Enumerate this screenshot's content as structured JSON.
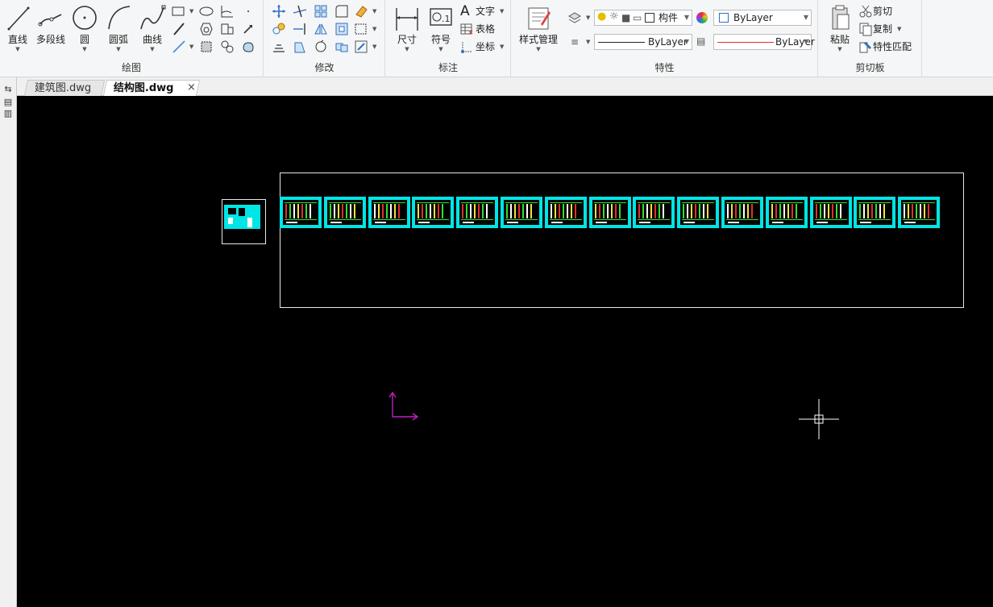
{
  "ribbon": {
    "draw": {
      "title": "绘图",
      "line": "直线",
      "polyline": "多段线",
      "circle": "圆",
      "arc": "圆弧",
      "spline": "曲线"
    },
    "modify": {
      "title": "修改"
    },
    "annotate": {
      "title": "标注",
      "dimension": "尺寸",
      "symbol": "符号",
      "text": "文字",
      "table": "表格",
      "coordinate": "坐标"
    },
    "properties": {
      "title": "特性",
      "style_manager": "样式管理",
      "layer_name": "构件",
      "color_value": "ByLayer",
      "linetype_value": "ByLayer",
      "lineweight_value": "ByLayer"
    },
    "clipboard": {
      "title": "剪切板",
      "paste": "粘贴",
      "cut": "剪切",
      "copy": "复制",
      "match_properties": "特性匹配"
    }
  },
  "tabs": [
    {
      "label": "建筑图.dwg",
      "active": false
    },
    {
      "label": "结构图.dwg",
      "active": true
    }
  ],
  "colors": {
    "sheet_border": "#00e5e5",
    "ucs_icon": "#c020c0",
    "canvas_bg": "#000000",
    "color_swatch_red": "#e03030"
  },
  "sheet_count": 15
}
